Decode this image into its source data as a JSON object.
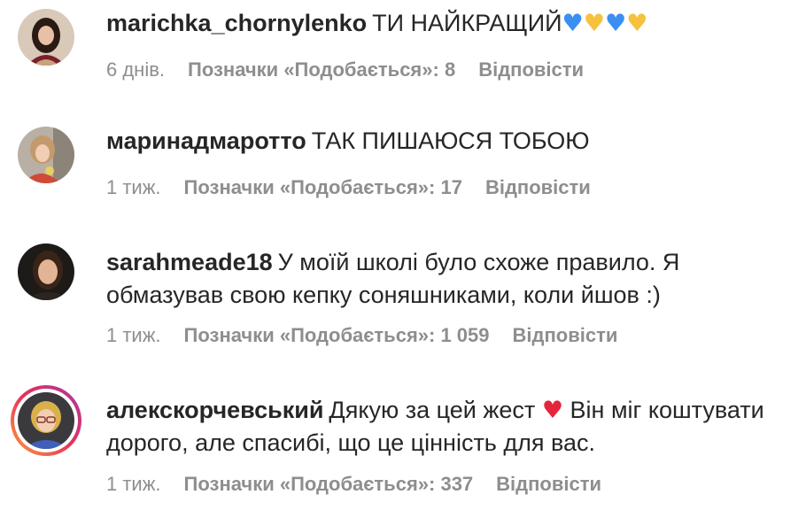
{
  "comments": [
    {
      "username": "marichka_chornylenko",
      "text": "ТИ НАЙКРАЩИЙ",
      "emojis": [
        {
          "glyph": "♥",
          "color": "#3b8ff0",
          "name": "blue-heart"
        },
        {
          "glyph": "♥",
          "color": "#f6c23e",
          "name": "yellow-heart"
        },
        {
          "glyph": "♥",
          "color": "#3b8ff0",
          "name": "blue-heart"
        },
        {
          "glyph": "♥",
          "color": "#f6c23e",
          "name": "yellow-heart"
        }
      ],
      "time": "6 днів.",
      "likes": "Позначки «Подобається»: 8",
      "reply": "Відповісти"
    },
    {
      "username": "маринадмаротто",
      "text": "ТАК ПИШАЮСЯ ТОБОЮ",
      "time": "1 тиж.",
      "likes": "Позначки «Подобається»: 17",
      "reply": "Відповісти"
    },
    {
      "username": "sarahmeade18",
      "text": "У моїй школі було схоже правило. Я обмазував свою кепку соняшниками, коли йшов :)",
      "time": "1 тиж.",
      "likes": "Позначки «Подобається»: 1 059",
      "reply": "Відповісти"
    },
    {
      "username": "алекскорчевський",
      "text_before": "Дякую за цей жест",
      "heart": "♥",
      "text_after": "Він міг коштувати дорого, але спасибі, що це цінність для вас.",
      "time": "1 тиж.",
      "likes": "Позначки «Подобається»: 337",
      "reply": "Відповісти"
    }
  ]
}
